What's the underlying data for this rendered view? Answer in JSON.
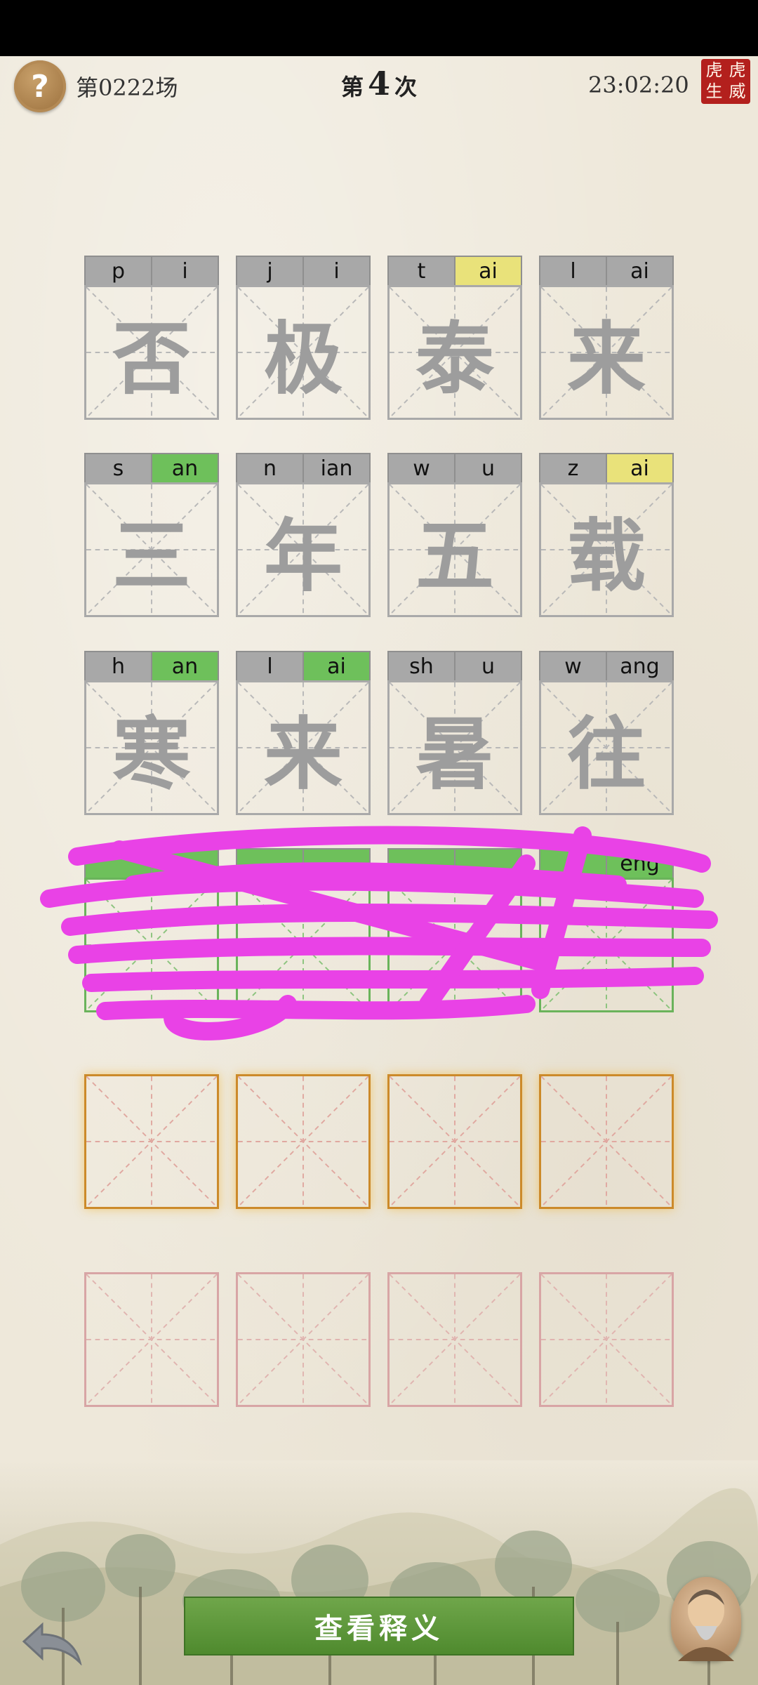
{
  "header": {
    "help_icon": "?",
    "session": "第0222场",
    "attempt_prefix": "第",
    "attempt_number": "4",
    "attempt_suffix": "次",
    "clock": "23:02:20",
    "seal": [
      "虎",
      "虎",
      "生",
      "威"
    ]
  },
  "rows": [
    [
      {
        "initial": "p",
        "final": "i",
        "initial_state": "gray",
        "final_state": "gray",
        "char": "否"
      },
      {
        "initial": "j",
        "final": "i",
        "initial_state": "gray",
        "final_state": "gray",
        "char": "极"
      },
      {
        "initial": "t",
        "final": "ai",
        "initial_state": "gray",
        "final_state": "yellow",
        "char": "泰"
      },
      {
        "initial": "l",
        "final": "ai",
        "initial_state": "gray",
        "final_state": "gray",
        "char": "来"
      }
    ],
    [
      {
        "initial": "s",
        "final": "an",
        "initial_state": "gray",
        "final_state": "green",
        "char": "三"
      },
      {
        "initial": "n",
        "final": "ian",
        "initial_state": "gray",
        "final_state": "gray",
        "char": "年"
      },
      {
        "initial": "w",
        "final": "u",
        "initial_state": "gray",
        "final_state": "gray",
        "char": "五"
      },
      {
        "initial": "z",
        "final": "ai",
        "initial_state": "gray",
        "final_state": "yellow",
        "char": "载"
      }
    ],
    [
      {
        "initial": "h",
        "final": "an",
        "initial_state": "gray",
        "final_state": "green",
        "char": "寒"
      },
      {
        "initial": "l",
        "final": "ai",
        "initial_state": "gray",
        "final_state": "green",
        "char": "来"
      },
      {
        "initial": "sh",
        "final": "u",
        "initial_state": "gray",
        "final_state": "gray",
        "char": "暑"
      },
      {
        "initial": "w",
        "final": "ang",
        "initial_state": "gray",
        "final_state": "gray",
        "char": "往"
      }
    ]
  ],
  "hidden_row_last_final": "eng",
  "bottom": {
    "view_button": "查看释义"
  },
  "colors": {
    "green": "#6ec05b",
    "yellow": "#e9e27a",
    "gray": "#a8a8a8",
    "scribble": "#e942e6",
    "button": "#5a9638"
  }
}
